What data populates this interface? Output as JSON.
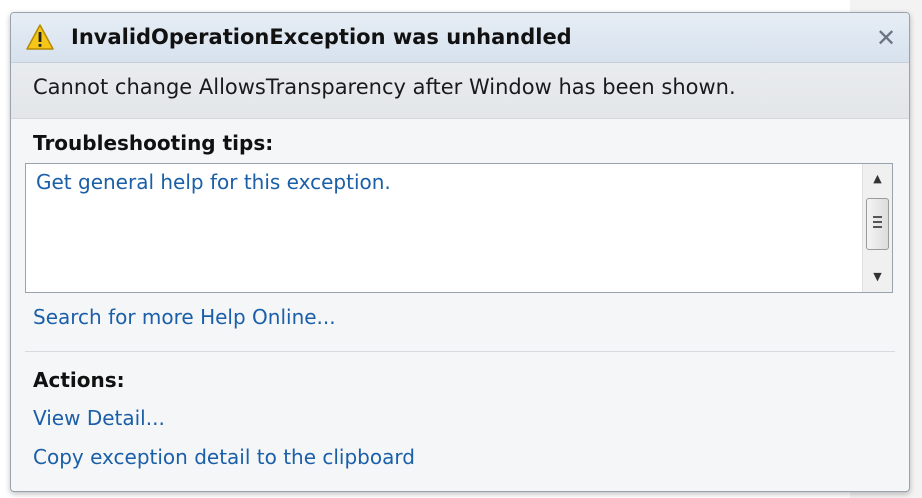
{
  "dialog": {
    "title": "InvalidOperationException was unhandled",
    "message": "Cannot change AllowsTransparency after Window has been shown.",
    "close_glyph": "✕"
  },
  "troubleshooting": {
    "heading": "Troubleshooting tips:",
    "tip_link": "Get general help for this exception.",
    "scroll_up_glyph": "▲",
    "scroll_down_glyph": "▼"
  },
  "search_link": "Search for more Help Online...",
  "actions": {
    "heading": "Actions:",
    "view_detail": "View Detail...",
    "copy_detail": "Copy exception detail to the clipboard"
  },
  "colors": {
    "link": "#1a5fa8",
    "warning_fill": "#f5c518",
    "warning_border": "#b58a00"
  },
  "icons": {
    "title": "warning-icon",
    "close": "close-icon"
  }
}
